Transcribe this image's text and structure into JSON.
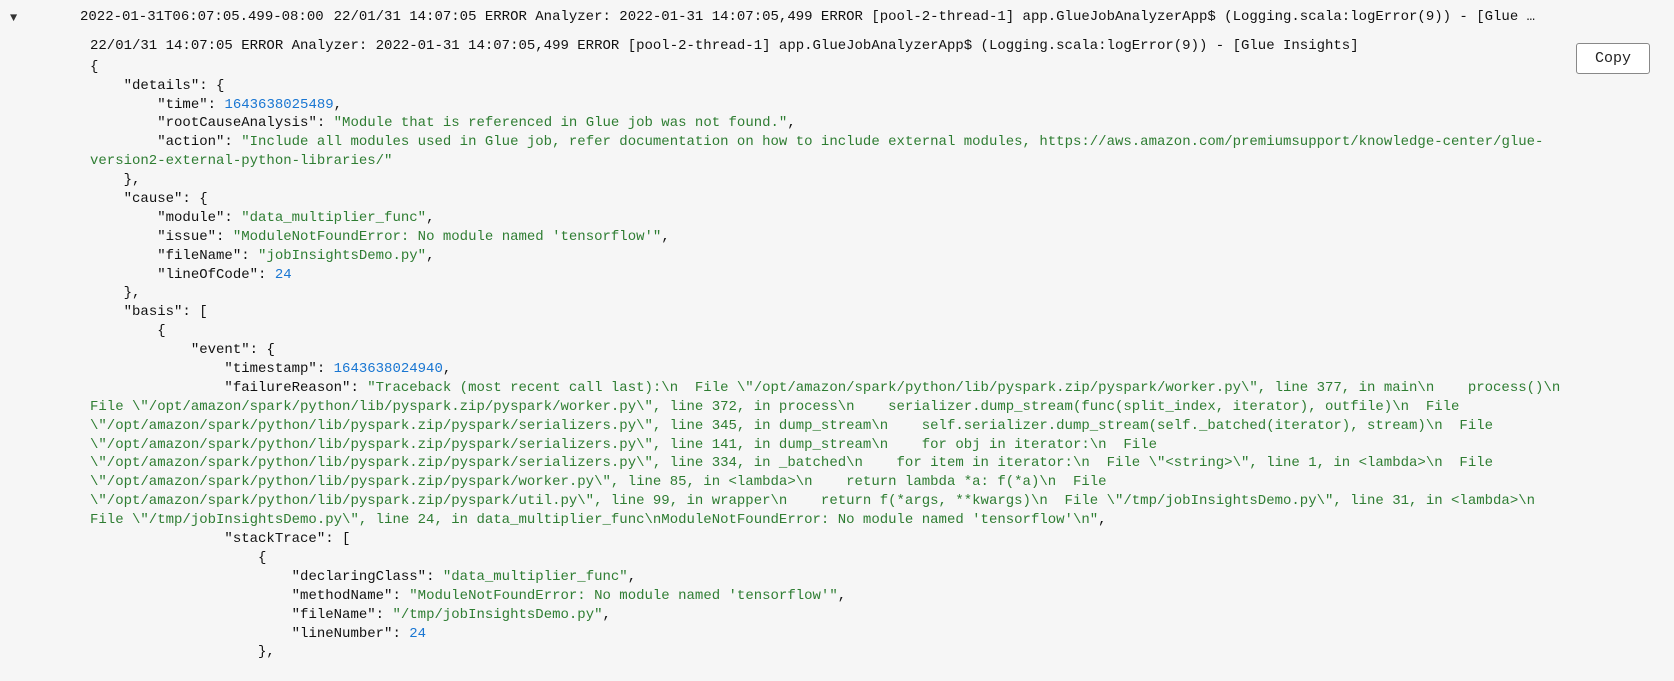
{
  "header": {
    "toggle_glyph": "▼",
    "timestamp": "2022-01-31T06:07:05.499-08:00",
    "summary": "22/01/31 14:07:05 ERROR Analyzer: 2022-01-31 14:07:05,499 ERROR [pool-2-thread-1] app.GlueJobAnalyzerApp$ (Logging.scala:logError(9)) - [Glue …"
  },
  "detail": {
    "header_line": "22/01/31 14:07:05 ERROR Analyzer: 2022-01-31 14:07:05,499 ERROR [pool-2-thread-1] app.GlueJobAnalyzerApp$ (Logging.scala:logError(9)) - [Glue Insights]",
    "copy_label": "Copy",
    "json": {
      "details": {
        "time": 1643638025489,
        "rootCauseAnalysis": "Module that is referenced in Glue job was not found.",
        "action": "Include all modules used in Glue job, refer documentation on how to include external modules, https://aws.amazon.com/premiumsupport/knowledge-center/glue-version2-external-python-libraries/"
      },
      "cause": {
        "module": "data_multiplier_func",
        "issue": "ModuleNotFoundError: No module named 'tensorflow'",
        "fileName": "jobInsightsDemo.py",
        "lineOfCode": 24
      },
      "basis_event": {
        "timestamp": 1643638024940,
        "failureReason": "Traceback (most recent call last):\\n  File \\\"/opt/amazon/spark/python/lib/pyspark.zip/pyspark/worker.py\\\", line 377, in main\\n    process()\\n  File \\\"/opt/amazon/spark/python/lib/pyspark.zip/pyspark/worker.py\\\", line 372, in process\\n    serializer.dump_stream(func(split_index, iterator), outfile)\\n  File \\\"/opt/amazon/spark/python/lib/pyspark.zip/pyspark/serializers.py\\\", line 345, in dump_stream\\n    self.serializer.dump_stream(self._batched(iterator), stream)\\n  File \\\"/opt/amazon/spark/python/lib/pyspark.zip/pyspark/serializers.py\\\", line 141, in dump_stream\\n    for obj in iterator:\\n  File \\\"/opt/amazon/spark/python/lib/pyspark.zip/pyspark/serializers.py\\\", line 334, in _batched\\n    for item in iterator:\\n  File \\\"<string>\\\", line 1, in <lambda>\\n  File \\\"/opt/amazon/spark/python/lib/pyspark.zip/pyspark/worker.py\\\", line 85, in <lambda>\\n    return lambda *a: f(*a)\\n  File \\\"/opt/amazon/spark/python/lib/pyspark.zip/pyspark/util.py\\\", line 99, in wrapper\\n    return f(*args, **kwargs)\\n  File \\\"/tmp/jobInsightsDemo.py\\\", line 31, in <lambda>\\n  File \\\"/tmp/jobInsightsDemo.py\\\", line 24, in data_multiplier_func\\nModuleNotFoundError: No module named 'tensorflow'\\n",
        "stackTrace": [
          {
            "declaringClass": "data_multiplier_func",
            "methodName": "ModuleNotFoundError: No module named 'tensorflow'",
            "fileName": "/tmp/jobInsightsDemo.py",
            "lineNumber": 24
          }
        ]
      }
    }
  }
}
